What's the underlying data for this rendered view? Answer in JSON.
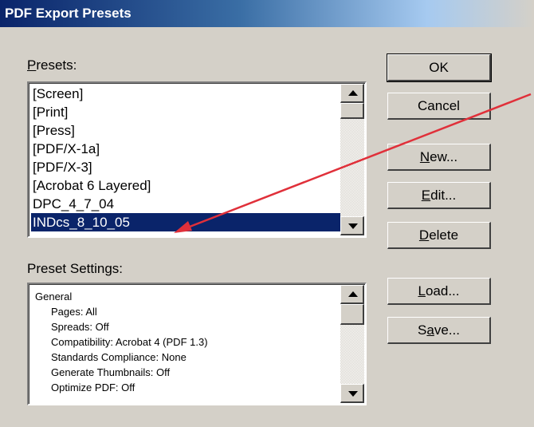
{
  "window": {
    "title": "PDF Export Presets"
  },
  "presets": {
    "label_mnemonic": "P",
    "label_rest": "resets:",
    "items": [
      "[Screen]",
      "[Print]",
      "[Press]",
      "[PDF/X-1a]",
      "[PDF/X-3]",
      "[Acrobat 6 Layered]",
      "DPC_4_7_04",
      "INDcs_8_10_05"
    ],
    "selected": "INDcs_8_10_05"
  },
  "settings": {
    "label": "Preset Settings:",
    "rows": [
      {
        "text": "General",
        "indent": false
      },
      {
        "text": "Pages: All",
        "indent": true
      },
      {
        "text": "Spreads: Off",
        "indent": true
      },
      {
        "text": "Compatibility: Acrobat 4 (PDF 1.3)",
        "indent": true
      },
      {
        "text": "Standards Compliance: None",
        "indent": true
      },
      {
        "text": "Generate Thumbnails: Off",
        "indent": true
      },
      {
        "text": "Optimize PDF: Off",
        "indent": true
      }
    ]
  },
  "buttons": {
    "ok": "OK",
    "cancel": "Cancel",
    "new_mnemonic": "N",
    "new_rest": "ew...",
    "edit_mnemonic": "E",
    "edit_rest": "dit...",
    "delete_mnemonic": "D",
    "delete_rest": "elete",
    "load_mnemonic": "L",
    "load_rest": "oad...",
    "save_pre": "S",
    "save_mnemonic": "a",
    "save_rest": "ve..."
  },
  "icons": {
    "scroll_up": "arrow-up-icon",
    "scroll_down": "arrow-down-icon"
  },
  "colors": {
    "dialog_bg": "#d4d0c8",
    "title_start": "#0a246a",
    "selection": "#0a246a",
    "annotation_arrow": "#e0303a"
  }
}
